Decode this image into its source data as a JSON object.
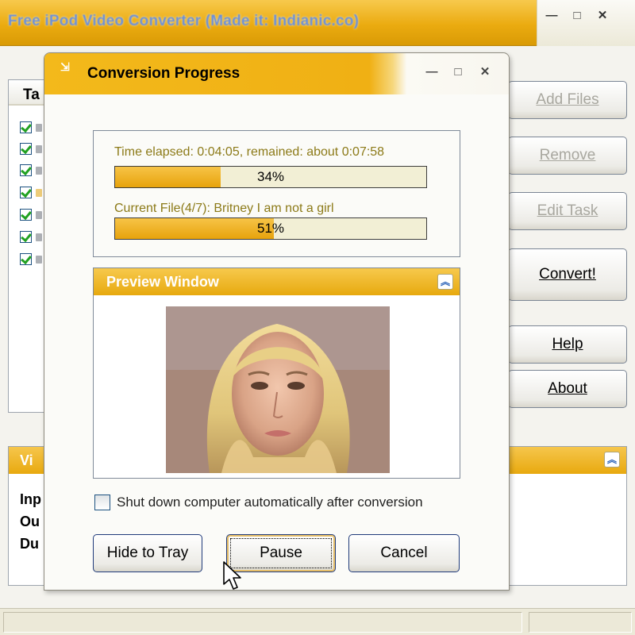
{
  "main_window": {
    "title": "Free iPod Video Converter (Made it: Indianic.co)",
    "controls": {
      "minimize": "—",
      "maximize": "□",
      "close": "✕"
    },
    "task_list": {
      "header": "Ta",
      "rows": 7
    },
    "buttons": {
      "add_files": "Add Files",
      "remove": "Remove",
      "edit_task": "Edit Task",
      "convert": "Convert!",
      "help": "Help",
      "about": "About"
    },
    "video_panel": {
      "header": "Vi",
      "labels": [
        "Inp",
        "Ou",
        "Du"
      ]
    }
  },
  "dialog": {
    "title": "Conversion Progress",
    "app_icon": "arrow-icon",
    "controls": {
      "minimize": "—",
      "maximize": "□",
      "close": "✕"
    },
    "time_status": "Time elapsed: 0:04:05, remained: about 0:07:58",
    "overall_progress": {
      "value": 0.34,
      "label": "34%"
    },
    "current_file": "Current File(4/7): Britney  I am not a girl",
    "file_progress": {
      "value": 0.51,
      "label": "51%"
    },
    "preview": {
      "header": "Preview Window",
      "collapse_icon": "double-chevron-up-icon"
    },
    "shutdown_option": {
      "label": "Shut down computer automatically after conversion",
      "checked": false
    },
    "buttons": {
      "hide_to_tray": "Hide to Tray",
      "pause": "Pause",
      "cancel": "Cancel"
    }
  },
  "colors": {
    "accent": "#f0b014",
    "progress_text": "#8c7a18",
    "checkbox_check": "#21a121"
  }
}
